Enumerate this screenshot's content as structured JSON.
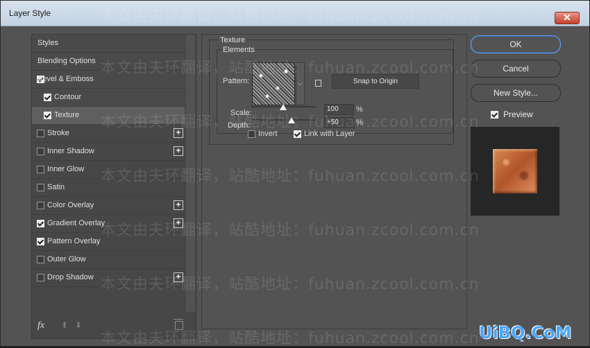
{
  "window": {
    "title": "Layer Style",
    "close_label": "✕"
  },
  "styles": {
    "items": [
      {
        "label": "Styles"
      },
      {
        "label": "Blending Options"
      },
      {
        "label": "Bevel & Emboss",
        "checked": true
      },
      {
        "label": "Contour",
        "checked": true
      },
      {
        "label": "Texture",
        "checked": true,
        "selected": true
      },
      {
        "label": "Stroke",
        "checked": false
      },
      {
        "label": "Inner Shadow",
        "checked": false
      },
      {
        "label": "Inner Glow",
        "checked": false
      },
      {
        "label": "Satin",
        "checked": false
      },
      {
        "label": "Color Overlay",
        "checked": false
      },
      {
        "label": "Gradient Overlay",
        "checked": true
      },
      {
        "label": "Pattern Overlay",
        "checked": true
      },
      {
        "label": "Outer Glow",
        "checked": false
      },
      {
        "label": "Drop Shadow",
        "checked": false
      }
    ],
    "footer": {
      "fx_label": "fx",
      "up_glyph": "⬆",
      "down_glyph": "⬇"
    }
  },
  "texture": {
    "group_title": "Texture",
    "elements_title": "Elements",
    "pattern_label": "Pattern:",
    "snap_label": "Snap to Origin",
    "scale_label": "Scale:",
    "scale_value": "100",
    "depth_label": "Depth:",
    "depth_value": "+50",
    "percent": "%",
    "invert_label": "Invert",
    "link_label": "Link with Layer",
    "dropdown_glyph": "⌵"
  },
  "buttons": {
    "ok": "OK",
    "cancel": "Cancel",
    "new_style": "New Style..."
  },
  "preview": {
    "label": "Preview"
  },
  "watermark": "本文由夫环翻译，站酷地址：fuhuan.zcool.com.cn",
  "logo": "UiBQ.CoM",
  "colors": {
    "dialog_bg": "#535353",
    "accent": "#2f6ab3",
    "copper": "#c86b3a"
  }
}
